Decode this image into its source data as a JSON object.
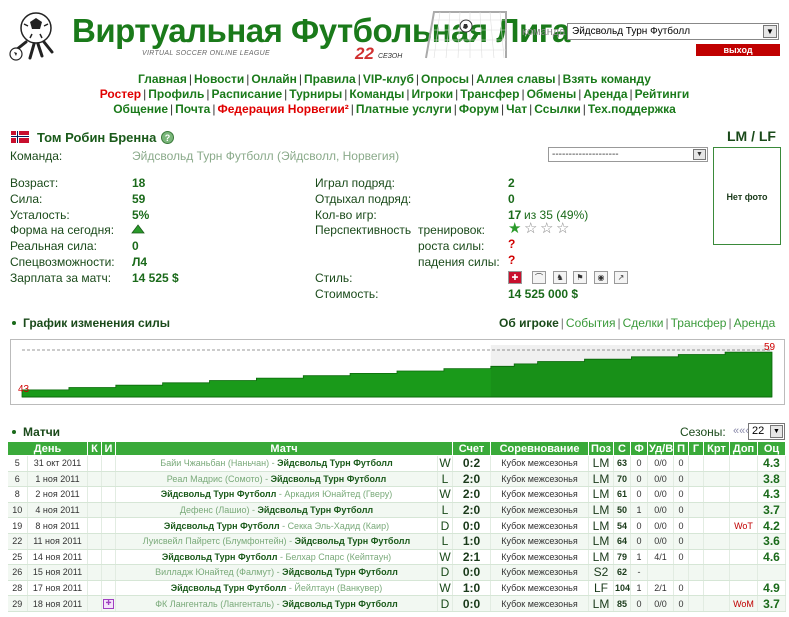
{
  "header": {
    "logo_title": "Виртуальная Футбольная Лига",
    "logo_subtitle": "VIRTUAL SOCCER ONLINE LEAGUE",
    "season_number": "22",
    "season_label": "СЕЗОН",
    "team_label": "команда",
    "team_selected": "Эйдсвольд Турн Футболл",
    "logout_label": "выход"
  },
  "nav": {
    "row1": [
      "Главная",
      "Новости",
      "Онлайн",
      "Правила",
      "VIP-клуб",
      "Опросы",
      "Аллея славы",
      "Взять команду"
    ],
    "row2": [
      "Ростер",
      "Профиль",
      "Расписание",
      "Турниры",
      "Команды",
      "Игроки",
      "Трансфер",
      "Обмены",
      "Аренда",
      "Рейтинги"
    ],
    "row3": [
      "Общение",
      "Почта",
      "Федерация Норвегии²",
      "Платные услуги",
      "Форум",
      "Чат",
      "Ссылки",
      "Тех.поддержка"
    ]
  },
  "player": {
    "name": "Том Робин Бренна",
    "help_glyph": "?",
    "position": "LM / LF",
    "team_label": "Команда:",
    "team_value": "Эйдсвольд Турн Футболл (Эйдсволл, Норвегия)",
    "select_placeholder": "--------------------",
    "photo_text": "Нет фото",
    "age_label": "Возраст:",
    "age": "18",
    "strength_label": "Сила:",
    "strength": "59",
    "fatigue_label": "Усталость:",
    "fatigue": "5%",
    "form_label": "Форма на сегодня:",
    "real_strength_label": "Реальная сила:",
    "real_strength": "0",
    "specials_label": "Спецвозможности:",
    "specials": "Л4",
    "salary_label": "Зарплата за матч:",
    "salary": "14 525 $",
    "played_label": "Играл подряд:",
    "played": "2",
    "rested_label": "Отдыхал подряд:",
    "rested": "0",
    "games_label": "Кол-во игр:",
    "games_count": "17",
    "games_of": "из 35 (49%)",
    "perspective_label": "Перспективность",
    "training_label": "тренировок:",
    "growth_label": "роста силы:",
    "decline_label": "падения силы:",
    "training_stars": 1,
    "training_stars_max": 4,
    "style_label": "Стиль:",
    "cost_label": "Стоимость:",
    "cost": "14 525 000 $",
    "style_icons": [
      "norway-style-icon",
      "shoe-icon",
      "runner-icon",
      "player-icon",
      "ball-icon",
      "cross-ball-icon"
    ]
  },
  "graph": {
    "title": "График изменения силы",
    "tabs": [
      "Об игроке",
      "События",
      "Сделки",
      "Трансфер",
      "Аренда"
    ],
    "start_label": "43",
    "end_label": "59"
  },
  "chart_data": {
    "type": "area",
    "title": "График изменения силы",
    "ylim": [
      40,
      62
    ],
    "values": [
      43,
      43,
      44,
      44,
      45,
      45,
      46,
      46,
      47,
      47,
      48,
      48,
      49,
      49,
      50,
      50,
      51,
      51,
      52,
      52,
      53,
      54,
      55,
      55,
      56,
      56,
      57,
      57,
      58,
      58,
      59,
      59
    ],
    "start_label": "43",
    "end_label": "59"
  },
  "matches": {
    "title": "Матчи",
    "seasons_label": "Сезоны:",
    "seasons_arrow": "«««",
    "season_selected": "22",
    "columns": [
      "День",
      "К",
      "И",
      "Матч",
      "",
      "Счет",
      "Соревнование",
      "Поз",
      "С",
      "Ф",
      "Уд/В",
      "П",
      "Г",
      "Крт",
      "Доп",
      "Оц"
    ],
    "rows": [
      {
        "n": "5",
        "date": "31 окт 2011",
        "k": "",
        "i": "",
        "home": "Байи Чжаньбан (Наньчан)",
        "away": "Эйдсвольд Турн Футболл",
        "home_me": false,
        "res": "W",
        "score": "0:2",
        "comp": "Кубок межсезонья",
        "pos": "LM",
        "s": "63",
        "f": "0",
        "sh": "0/0",
        "p": "0",
        "g": "",
        "krt": "",
        "dop": "",
        "rating": "4.3"
      },
      {
        "n": "6",
        "date": "1 ноя 2011",
        "k": "",
        "i": "",
        "home": "Реал Мадрис (Сомото)",
        "away": "Эйдсвольд Турн Футболл",
        "home_me": false,
        "res": "L",
        "score": "2:0",
        "comp": "Кубок межсезонья",
        "pos": "LM",
        "s": "70",
        "f": "0",
        "sh": "0/0",
        "p": "0",
        "g": "",
        "krt": "",
        "dop": "",
        "rating": "3.8"
      },
      {
        "n": "8",
        "date": "2 ноя 2011",
        "k": "",
        "i": "",
        "home": "Эйдсвольд Турн Футболл",
        "away": "Аркадия Юнайтед (Гверу)",
        "home_me": true,
        "res": "W",
        "score": "2:0",
        "comp": "Кубок межсезонья",
        "pos": "LM",
        "s": "61",
        "f": "0",
        "sh": "0/0",
        "p": "0",
        "g": "",
        "krt": "",
        "dop": "",
        "rating": "4.3"
      },
      {
        "n": "10",
        "date": "4 ноя 2011",
        "k": "",
        "i": "",
        "home": "Дефенс (Лашио)",
        "away": "Эйдсвольд Турн Футболл",
        "home_me": false,
        "res": "L",
        "score": "2:0",
        "comp": "Кубок межсезонья",
        "pos": "LM",
        "s": "50",
        "f": "1",
        "sh": "0/0",
        "p": "0",
        "g": "",
        "krt": "",
        "dop": "",
        "rating": "3.7"
      },
      {
        "n": "19",
        "date": "8 ноя 2011",
        "k": "",
        "i": "",
        "home": "Эйдсвольд Турн Футболл",
        "away": "Секка Эль-Хадид (Каир)",
        "home_me": true,
        "res": "D",
        "score": "0:0",
        "comp": "Кубок межсезонья",
        "pos": "LM",
        "s": "54",
        "f": "0",
        "sh": "0/0",
        "p": "0",
        "g": "",
        "krt": "",
        "dop": "WoT",
        "rating": "4.2"
      },
      {
        "n": "22",
        "date": "11 ноя 2011",
        "k": "",
        "i": "",
        "home": "Луисвейл Пайретс (Блумфонтейн)",
        "away": "Эйдсвольд Турн Футболл",
        "home_me": false,
        "res": "L",
        "score": "1:0",
        "comp": "Кубок межсезонья",
        "pos": "LM",
        "s": "64",
        "f": "0",
        "sh": "0/0",
        "p": "0",
        "g": "",
        "krt": "",
        "dop": "",
        "rating": "3.6"
      },
      {
        "n": "25",
        "date": "14 ноя 2011",
        "k": "",
        "i": "",
        "home": "Эйдсвольд Турн Футболл",
        "away": "Белхар Спарс (Кейптаун)",
        "home_me": true,
        "res": "W",
        "score": "2:1",
        "comp": "Кубок межсезонья",
        "pos": "LM",
        "s": "79",
        "f": "1",
        "sh": "4/1",
        "p": "0",
        "g": "",
        "krt": "",
        "dop": "",
        "rating": "4.6"
      },
      {
        "n": "26",
        "date": "15 ноя 2011",
        "k": "",
        "i": "",
        "home": "Вилладж Юнайтед (Фалмут)",
        "away": "Эйдсвольд Турн Футболл",
        "home_me": false,
        "res": "D",
        "score": "0:0",
        "comp": "Кубок межсезонья",
        "pos": "S2",
        "s": "62",
        "f": "-",
        "sh": "",
        "p": "",
        "g": "",
        "krt": "",
        "dop": "",
        "rating": ""
      },
      {
        "n": "28",
        "date": "17 ноя 2011",
        "k": "",
        "i": "",
        "home": "Эйдсвольд Турн Футболл",
        "away": "Йейлтаун (Ванкувер)",
        "home_me": true,
        "res": "W",
        "score": "1:0",
        "comp": "Кубок межсезонья",
        "pos": "LF",
        "s": "104",
        "f": "1",
        "sh": "2/1",
        "p": "0",
        "g": "",
        "krt": "",
        "dop": "",
        "rating": "4.9"
      },
      {
        "n": "29",
        "date": "18 ноя 2011",
        "k": "",
        "i": "✚",
        "home": "ФК Лангенталь (Лангенталь)",
        "away": "Эйдсвольд Турн Футболл",
        "home_me": false,
        "res": "D",
        "score": "0:0",
        "comp": "Кубок межсезонья",
        "pos": "LM",
        "s": "85",
        "f": "0",
        "sh": "0/0",
        "p": "0",
        "g": "",
        "krt": "",
        "dop": "WoM",
        "rating": "3.7"
      }
    ]
  }
}
